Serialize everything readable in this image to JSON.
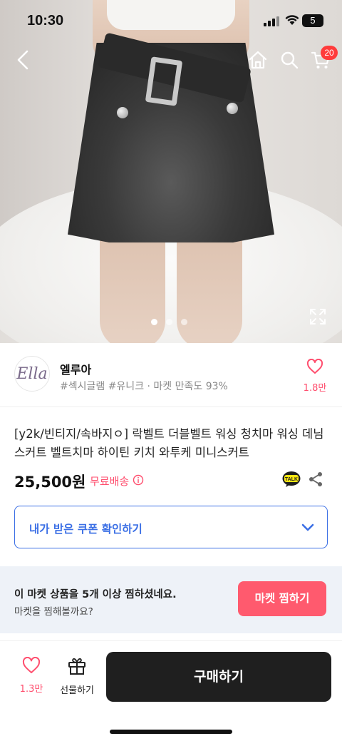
{
  "status_bar": {
    "time": "10:30",
    "battery": "5"
  },
  "nav": {
    "cart_count": "20"
  },
  "gallery": {
    "pages": 3,
    "active_page": 1
  },
  "shop": {
    "logo_text": "Ella",
    "name": "엘루아",
    "tags": "#섹시글램 #유니크 · 마켓 만족도 93%",
    "like_count": "1.8만"
  },
  "product": {
    "title": "[y2k/빈티지/속바지ㅇ] 락벨트 더블벨트 워싱 청치마 워싱 데님 스커트 벨트치마 하이틴 키치 와투케 미니스커트",
    "price": "25,500원",
    "shipping": "무료배송"
  },
  "coupon": {
    "label": "내가 받은 쿠폰 확인하기"
  },
  "follow_banner": {
    "title": "이 마켓 상품을 5개 이상 찜하셨네요.",
    "subtitle": "마켓을 찜해볼까요?",
    "button": "마켓 찜하기"
  },
  "bottom_bar": {
    "like_count": "1.3만",
    "gift_label": "선물하기",
    "buy_label": "구매하기"
  },
  "colors": {
    "accent_pink": "#ff4d6d",
    "coupon_blue": "#3b6fe5",
    "buy_black": "#1f1f1f",
    "banner_bg": "#eef2f8",
    "badge_red": "#ff3b3b"
  }
}
